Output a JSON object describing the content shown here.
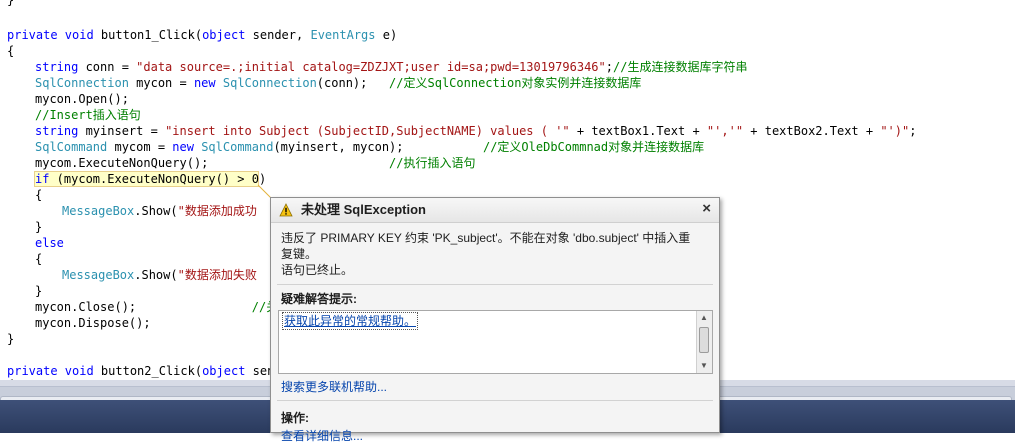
{
  "code": {
    "l0": "}",
    "l1_a": "private void ",
    "l1_b": "button1_Click(",
    "l1_c": "object",
    "l1_d": " sender, ",
    "l1_e": "EventArgs",
    "l1_f": " e)",
    "l2": "{",
    "l3_a": "string",
    "l3_b": " conn = ",
    "l3_c": "\"data source=.;initial catalog=ZDZJXT;user id=sa;pwd=13019796346\"",
    "l3_d": ";",
    "l3_e": "//生成连接数据库字符串",
    "l4_a": "SqlConnection",
    "l4_b": " mycon = ",
    "l4_c": "new",
    "l4_d": " ",
    "l4_e": "SqlConnection",
    "l4_f": "(conn);   ",
    "l4_g": "//定义SqlConnection对象实例并连接数据库",
    "l5": "mycon.Open();",
    "l6": "//Insert插入语句",
    "l7_a": "string",
    "l7_b": " myinsert = ",
    "l7_c": "\"insert into Subject (SubjectID,SubjectNAME) values ( '\"",
    "l7_d": " + textBox1.Text + ",
    "l7_e": "\"','\"",
    "l7_f": " + textBox2.Text + ",
    "l7_g": "\"')\"",
    "l7_h": ";",
    "l8_a": "SqlCommand",
    "l8_b": " mycom = ",
    "l8_c": "new",
    "l8_d": " ",
    "l8_e": "SqlCommand",
    "l8_f": "(myinsert, mycon);           ",
    "l8_g": "//定义OleDbCommnad对象并连接数据库",
    "l9_a": "mycom.ExecuteNonQuery();                         ",
    "l9_b": "//执行插入语句",
    "l10_a": "if",
    "l10_b": " (mycom.ExecuteNonQuery() > 0)",
    "l11": "{",
    "l12_a": "MessageBox",
    "l12_b": ".Show(",
    "l12_c": "\"数据添加成功",
    "l13": "}",
    "l14": "else",
    "l15": "{",
    "l16_a": "MessageBox",
    "l16_b": ".Show(",
    "l16_c": "\"数据添加失败",
    "l17": "}",
    "l18_a": "mycon.Close();                ",
    "l18_b": "//关",
    "l19": "mycon.Dispose();",
    "l20": "}",
    "l21_a": "private void ",
    "l21_b": "button2_Click(",
    "l21_c": "object",
    "l21_d": " sende",
    "l22": "{"
  },
  "popup": {
    "title": "未处理 SqlException",
    "close": "×",
    "message_line1": "违反了 PRIMARY KEY 约束 'PK_subject'。不能在对象 'dbo.subject' 中插入重",
    "message_line2": "复键。",
    "message_line3": "语句已终止。",
    "tips_label": "疑难解答提示:",
    "tip_link": "获取此异常的常规帮助。",
    "more_help": "搜索更多联机帮助...",
    "ops_label": "操作:",
    "ops_link": "查看详细信息..."
  },
  "colors": {
    "keyword": "#0000ff",
    "type": "#2b91af",
    "string": "#a31515",
    "comment": "#008000",
    "link": "#0645ad"
  }
}
